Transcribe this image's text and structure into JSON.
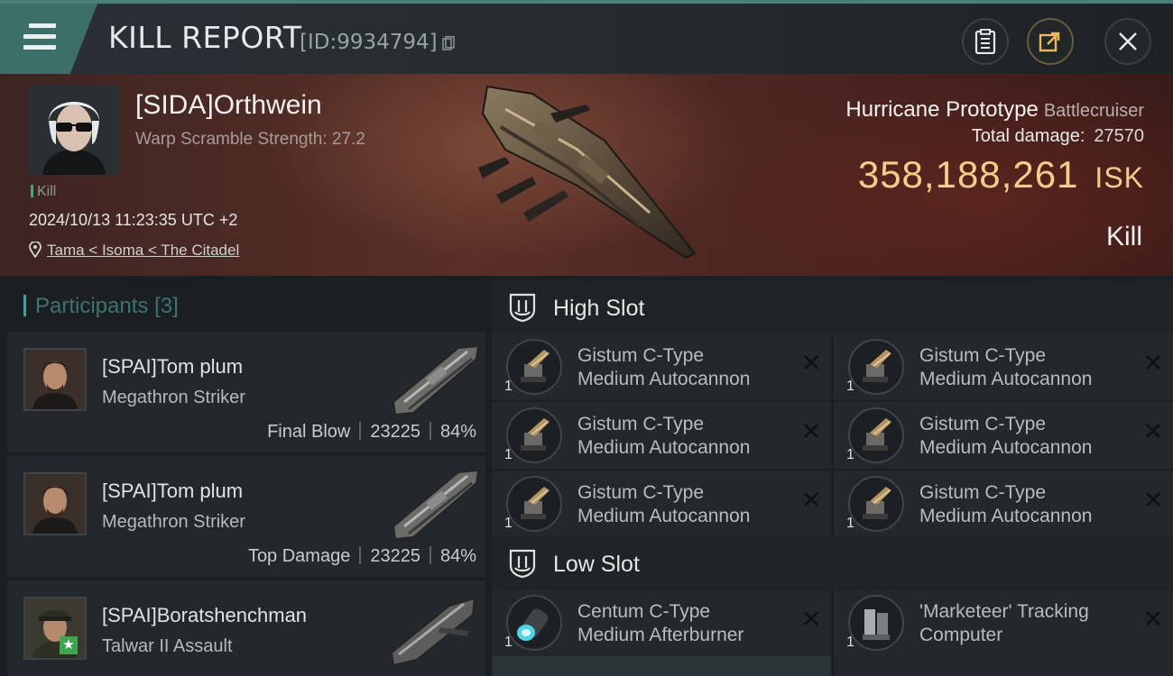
{
  "header": {
    "title": "KILL REPORT",
    "report_id": "[ID:9934794]"
  },
  "victim": {
    "name": "[SIDA]Orthwein",
    "warp_scramble": "Warp Scramble Strength: 27.2",
    "kill_tag": "Kill",
    "datetime": "2024/10/13 11:23:35 UTC +2",
    "location": "Tama < Isoma < The Citadel",
    "ship_name": "Hurricane Prototype",
    "ship_class": "Battlecruiser",
    "total_damage_label": "Total damage:",
    "total_damage": "27570",
    "isk_value": "358,188,261",
    "isk_unit": "ISK",
    "result": "Kill"
  },
  "participants": {
    "label": "Participants",
    "count": "[3]",
    "rows": [
      {
        "name": "[SPAI]Tom plum",
        "ship": "Megathron Striker",
        "role": "Final Blow",
        "damage": "23225",
        "percent": "84%"
      },
      {
        "name": "[SPAI]Tom plum",
        "ship": "Megathron Striker",
        "role": "Top Damage",
        "damage": "23225",
        "percent": "84%"
      },
      {
        "name": "[SPAI]Boratshenchman",
        "ship": "Talwar II Assault",
        "role": "",
        "damage": "",
        "percent": ""
      }
    ]
  },
  "slots": {
    "high": {
      "title": "High Slot",
      "modules": [
        {
          "name_line1": "Gistum C-Type",
          "name_line2": "Medium Autocannon",
          "qty": "1"
        },
        {
          "name_line1": "Gistum C-Type",
          "name_line2": "Medium Autocannon",
          "qty": "1"
        },
        {
          "name_line1": "Gistum C-Type",
          "name_line2": "Medium Autocannon",
          "qty": "1"
        },
        {
          "name_line1": "Gistum C-Type",
          "name_line2": "Medium Autocannon",
          "qty": "1"
        },
        {
          "name_line1": "Gistum C-Type",
          "name_line2": "Medium Autocannon",
          "qty": "1"
        },
        {
          "name_line1": "Gistum C-Type",
          "name_line2": "Medium Autocannon",
          "qty": "1"
        }
      ]
    },
    "low": {
      "title": "Low Slot",
      "modules": [
        {
          "name_line1": "Centum C-Type",
          "name_line2": "Medium Afterburner",
          "qty": "1"
        },
        {
          "name_line1": "'Marketeer' Tracking",
          "name_line2": "Computer",
          "qty": "1"
        }
      ]
    }
  },
  "colors": {
    "accent_teal": "#3d6f6a",
    "isk_gold": "#f1cf8a",
    "star_green": "#3fa64f"
  }
}
